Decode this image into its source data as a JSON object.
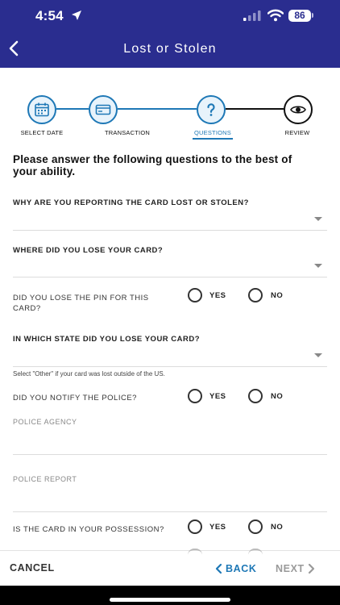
{
  "status": {
    "time": "4:54",
    "battery": "86"
  },
  "header": {
    "title": "Lost or Stolen"
  },
  "stepper": {
    "steps": [
      {
        "label": "SELECT DATE",
        "icon": "calendar-icon"
      },
      {
        "label": "TRANSACTION",
        "icon": "card-icon"
      },
      {
        "label": "QUESTIONS",
        "icon": "question-icon"
      },
      {
        "label": "REVIEW",
        "icon": "eye-icon"
      }
    ],
    "active": 2
  },
  "form": {
    "intro": "Please answer the following questions to the best of your ability.",
    "q_why": "WHY ARE YOU REPORTING THE CARD LOST OR STOLEN?",
    "q_where": "WHERE DID YOU LOSE YOUR CARD?",
    "q_pin": "DID YOU LOSE THE PIN FOR THIS CARD?",
    "q_state": "IN WHICH STATE DID YOU LOSE YOUR CARD?",
    "state_hint": "Select \"Other\" if your card was lost outside of the US.",
    "q_police": "DID YOU NOTIFY THE POLICE?",
    "police_agency_placeholder": "POLICE AGENCY",
    "police_report_placeholder": "POLICE REPORT",
    "q_possession": "IS THE CARD IN YOUR POSSESSION?",
    "yes": "YES",
    "no": "NO"
  },
  "footer": {
    "cancel": "CANCEL",
    "back": "BACK",
    "next": "NEXT"
  },
  "colors": {
    "header": "#2a2d8f",
    "accent": "#1e78b6",
    "disabled": "#9a9a9a"
  }
}
